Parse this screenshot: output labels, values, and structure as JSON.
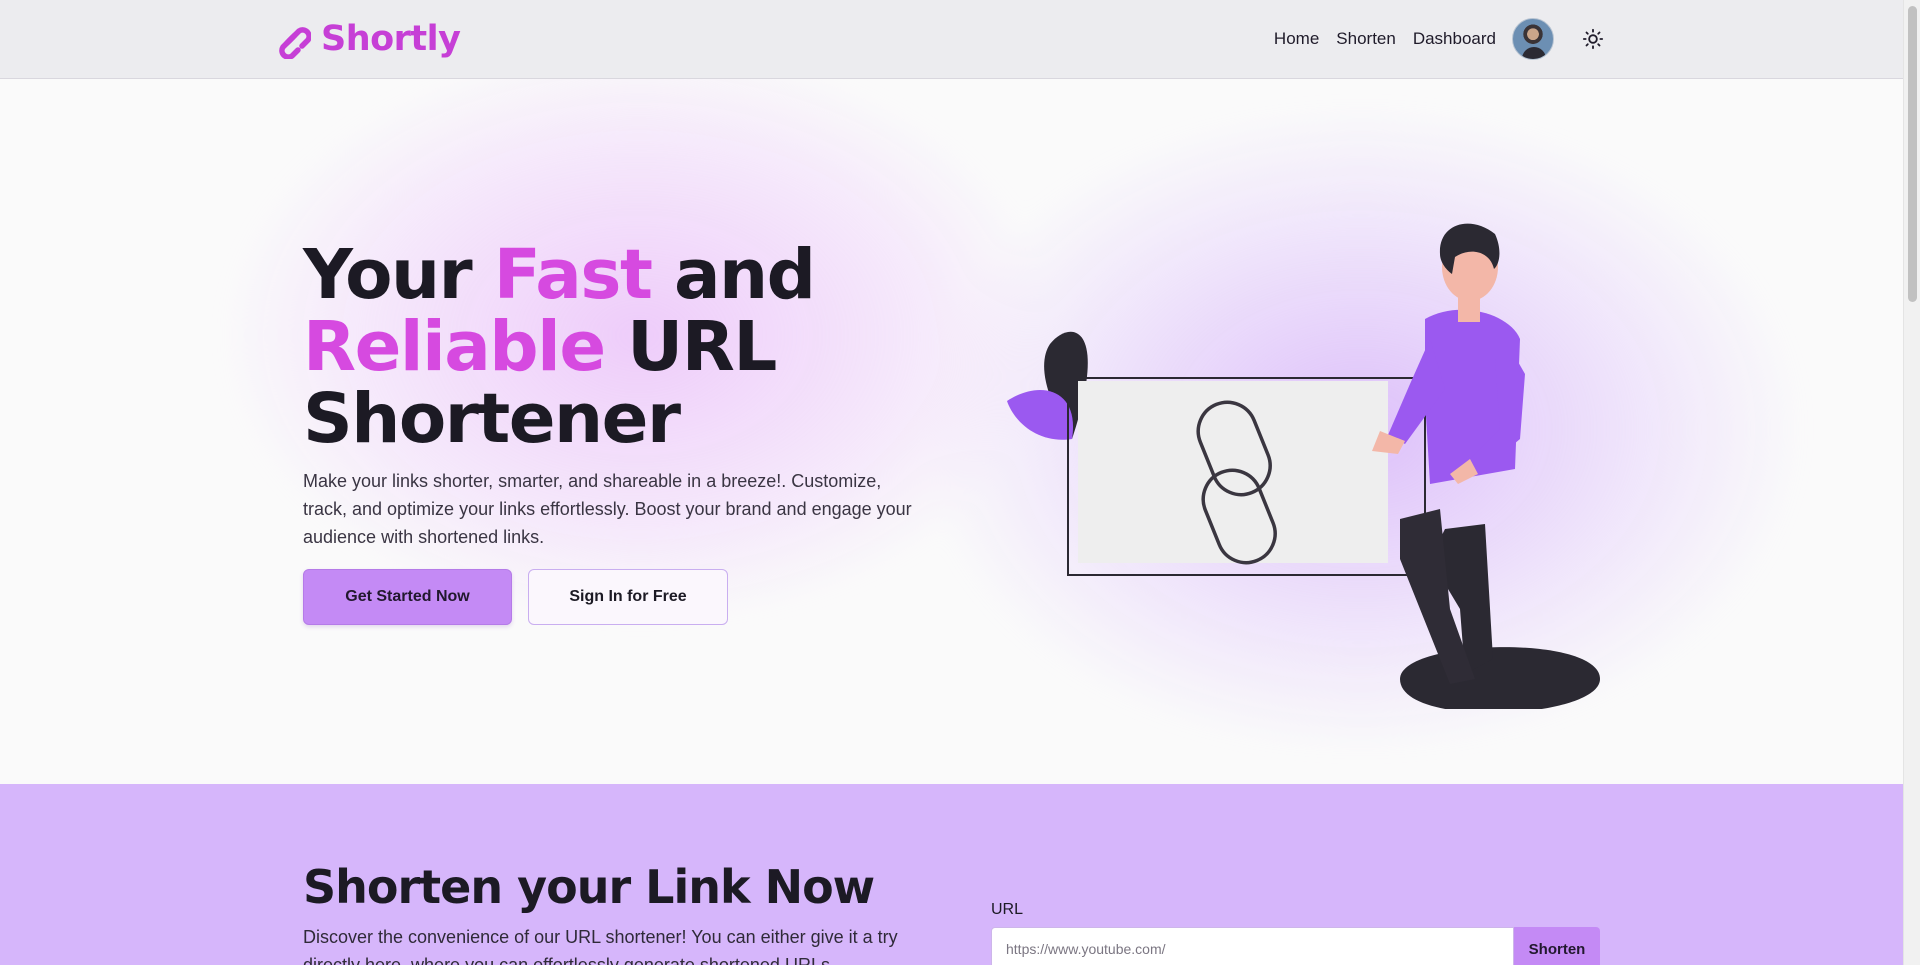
{
  "header": {
    "brand": "Shortly",
    "nav": [
      {
        "label": "Home"
      },
      {
        "label": "Shorten"
      },
      {
        "label": "Dashboard"
      }
    ],
    "avatar_icon": "user-avatar",
    "theme_icon": "sun-icon"
  },
  "hero": {
    "title_part1": "Your ",
    "title_highlight1": "Fast",
    "title_part2": " and ",
    "title_highlight2": "Reliable",
    "title_part3": " URL Shortener",
    "description": "Make your links shorter, smarter, and shareable in a breeze!. Customize, track, and optimize your links effortlessly. Boost your brand and engage your audience with shortened links.",
    "primary_button": "Get Started Now",
    "secondary_button": "Sign In for Free",
    "illustration_icon": "link-chain-illustration"
  },
  "shorten": {
    "title": "Shorten your Link Now",
    "description": "Discover the convenience of our URL shortener! You can either give it a try directly here, where you can effortlessly generate shortened URLs.",
    "url_label": "URL",
    "url_placeholder": "https://www.youtube.com/",
    "button": "Shorten"
  },
  "colors": {
    "brand": "#c63fd6",
    "highlight": "#d64ae0",
    "primary_button": "#c48af5",
    "section_bg": "#d6b6fb"
  }
}
